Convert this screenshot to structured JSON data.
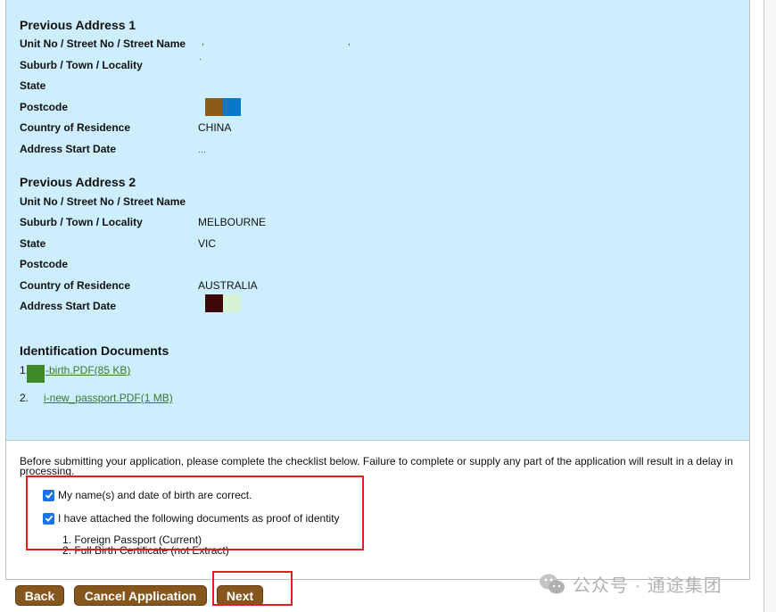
{
  "previous_address_1": {
    "title": "Previous Address 1",
    "fields": [
      {
        "label": "Unit No / Street No / Street Name",
        "value": ",",
        "value2": ","
      },
      {
        "label": "Suburb / Town / Locality",
        "value": "."
      },
      {
        "label": "State",
        "value": ""
      },
      {
        "label": "Postcode",
        "value": ""
      },
      {
        "label": "Country of Residence",
        "value": "CHINA"
      },
      {
        "label": "Address Start Date",
        "value": "…"
      }
    ]
  },
  "previous_address_2": {
    "title": "Previous Address 2",
    "fields": [
      {
        "label": "Unit No / Street No / Street Name",
        "value": ""
      },
      {
        "label": "Suburb / Town / Locality",
        "value": "MELBOURNE"
      },
      {
        "label": "State",
        "value": "VIC"
      },
      {
        "label": "Postcode",
        "value": ""
      },
      {
        "label": "Country of Residence",
        "value": "AUSTRALIA"
      },
      {
        "label": "Address Start Date",
        "value": ""
      }
    ]
  },
  "identification": {
    "title": "Identification Documents",
    "documents": [
      {
        "number": "1.",
        "link": "-birth.PDF(85 KB)"
      },
      {
        "number": "2.",
        "link": "i-new_passport.PDF(1 MB)"
      }
    ]
  },
  "checklist": {
    "intro": "Before submitting your application, please complete the checklist below. Failure to complete or supply any part of the application will result in a delay in processing.",
    "items": [
      {
        "label": "My name(s) and date of birth are correct.",
        "checked": true
      },
      {
        "label": "I have attached the following documents as proof of identity",
        "checked": true
      }
    ],
    "proof_list": [
      "1. Foreign Passport (Current)",
      "2. Full Birth Certificate (not Extract)"
    ]
  },
  "buttons": {
    "back": "Back",
    "cancel": "Cancel Application",
    "next": "Next"
  },
  "watermark": {
    "text": "公众号 · 通途集团",
    "icon": "wechat-icon"
  },
  "colors": {
    "panel_bg": "#cdeefe",
    "button_bg": "#86561f",
    "highlight": "#e02020",
    "link": "#3b7a2c",
    "checkbox": "#1a73e8"
  }
}
